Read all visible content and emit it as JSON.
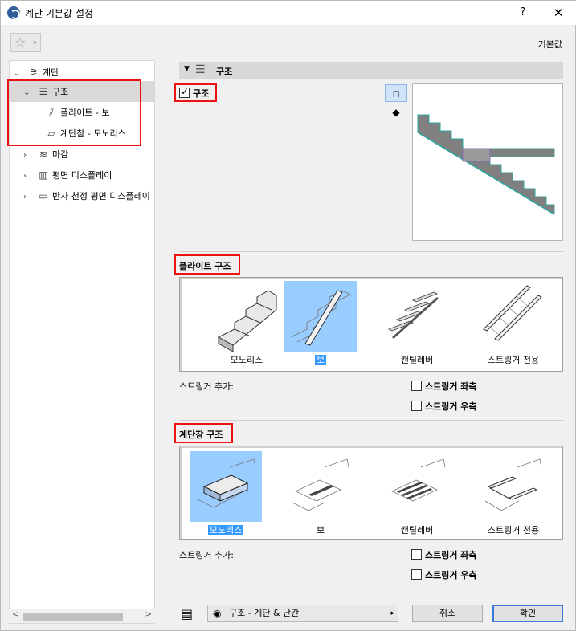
{
  "window": {
    "title": "계단 기본값 설정",
    "help": "?",
    "close": "✕"
  },
  "toolbar": {
    "favorites_icon": "☆",
    "favorites_caret": "▸",
    "default_label": "기본값"
  },
  "tree": {
    "items": [
      {
        "label": "계단",
        "icon": "stair-icon",
        "glyph": "⚞",
        "chev": "⌄"
      },
      {
        "label": "구조",
        "icon": "structure-icon",
        "glyph": "☰",
        "chev": "⌄"
      },
      {
        "label": "플라이트 - 보",
        "icon": "flight-beam-icon",
        "glyph": "⫽"
      },
      {
        "label": "계단참 - 모노리스",
        "icon": "landing-monolith-icon",
        "glyph": "▱"
      },
      {
        "label": "마감",
        "icon": "finish-icon",
        "glyph": "≋",
        "chev": "›"
      },
      {
        "label": "평면 디스플레이",
        "icon": "floor-plan-display-icon",
        "glyph": "▥",
        "chev": "›"
      },
      {
        "label": "반사 천정 평면 디스플레이",
        "icon": "reflected-ceiling-display-icon",
        "glyph": "▭",
        "chev": "›"
      }
    ],
    "scroll_left": "<",
    "scroll_right": ">"
  },
  "panel": {
    "header": "구조",
    "structure_checkbox_label": "구조",
    "structure_checked": true,
    "view_2d_glyph": "⊓",
    "view_3d_glyph": "◆"
  },
  "flight": {
    "title": "플라이트 구조",
    "options": [
      {
        "label": "모노리스",
        "selected": false
      },
      {
        "label": "보",
        "selected": true
      },
      {
        "label": "캔틸레버",
        "selected": false
      },
      {
        "label": "스트링거 전용",
        "selected": false
      }
    ],
    "stringer_add_label": "스트링거 추가:",
    "stringer_left": "스트링거 좌측",
    "stringer_right": "스트링거 우측"
  },
  "landing": {
    "title": "계단참 구조",
    "options": [
      {
        "label": "모노리스",
        "selected": true
      },
      {
        "label": "보",
        "selected": false
      },
      {
        "label": "캔틸레버",
        "selected": false
      },
      {
        "label": "스트링거 전용",
        "selected": false
      }
    ],
    "stringer_add_label": "스트링거 추가:",
    "stringer_left": "스트링거 좌측",
    "stringer_right": "스트링거 우측"
  },
  "footer": {
    "preset": "구조 - 계단 & 난간",
    "preset_arrow": "▸",
    "cancel": "취소",
    "ok": "확인"
  },
  "colors": {
    "selection_bg": "#99ccff",
    "selection_caption": "#3399ff",
    "highlight_border": "#ee1111",
    "stair_fill": "#808080",
    "stair_edge": "#2aa7a0"
  }
}
